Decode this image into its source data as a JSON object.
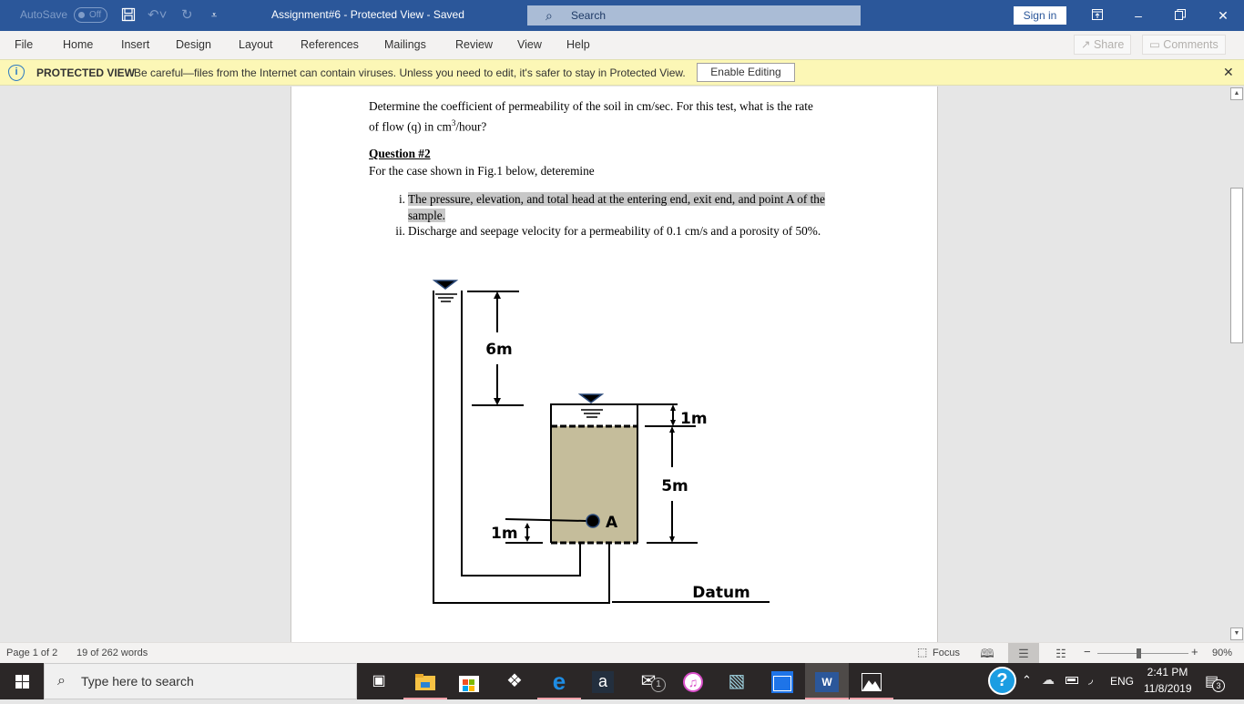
{
  "titlebar": {
    "autosave_label": "AutoSave",
    "autosave_state": "Off",
    "doc_title": "Assignment#6  -  Protected View  -  Saved",
    "search_placeholder": "Search",
    "signin_label": "Sign in",
    "icons": [
      "save-icon",
      "undo-icon",
      "redo-icon",
      "customize-qat-icon",
      "ribbon-display-icon",
      "minimize-icon",
      "restore-icon",
      "close-icon"
    ]
  },
  "menu": {
    "items": [
      "File",
      "Home",
      "Insert",
      "Design",
      "Layout",
      "References",
      "Mailings",
      "Review",
      "View",
      "Help"
    ],
    "share_label": "Share",
    "comments_label": "Comments"
  },
  "protected_view": {
    "label": "PROTECTED VIEW",
    "message": "Be careful—files from the Internet can contain viruses. Unless you need to edit, it's safer to stay in Protected View.",
    "enable_button": "Enable Editing"
  },
  "document": {
    "para1_line1": "Determine the coefficient of permeability of the soil in cm/sec. For this test, what is the rate",
    "para1_line2_pre": "of flow (q) in cm",
    "para1_line2_sup": "3",
    "para1_line2_post": "/hour?",
    "question_heading": "Question #2",
    "question_intro": "For the case shown in Fig.1 below, deteremine",
    "list": [
      {
        "num": "i.",
        "line1": "The pressure, elevation, and total head at the entering end, exit end, and point A of the",
        "line2": "sample. "
      },
      {
        "num": "ii.",
        "line1": "Discharge and seepage velocity for a permeability of 0.1 cm/s and a porosity of 50%."
      }
    ],
    "figure": {
      "labels": {
        "head_diff": "6m",
        "water_above_soil": "1m",
        "soil_height": "5m",
        "point_a_height": "1m",
        "point_label": "A",
        "datum": "Datum"
      },
      "soil_color": "#c5bd9b",
      "water_marker_color": "#2b4a7a"
    }
  },
  "statusbar": {
    "page": "Page 1 of 2",
    "words": "19 of 262 words",
    "focus_label": "Focus",
    "zoom_level": "90%",
    "zoom_fraction": 0.45
  },
  "taskbar": {
    "search_placeholder": "Type here to search",
    "apps": [
      "task-view",
      "file-explorer",
      "microsoft-store",
      "dropbox",
      "edge",
      "amazon",
      "mail",
      "itunes",
      "notepad",
      "window-app",
      "word",
      "photos"
    ],
    "mail_badge": "1",
    "tray_language": "ENG",
    "time": "2:41 PM",
    "date": "11/8/2019",
    "notification_count": "3"
  }
}
